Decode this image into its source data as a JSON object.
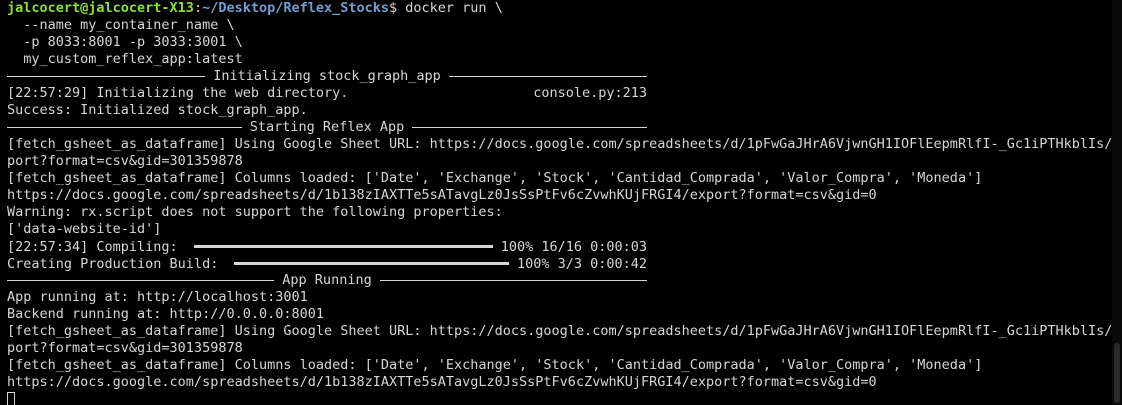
{
  "prompt": {
    "user": "jalcocert@jalcocert-X13",
    "separator": ":",
    "path": "~/Desktop/Reflex_Stocks",
    "symbol": "$",
    "command": " docker run \\"
  },
  "command_args": [
    "  --name my_container_name \\",
    "  -p 8033:8001 -p 3033:3001 \\",
    "  my_custom_reflex_app:latest"
  ],
  "sections": {
    "init": "Initializing stock_graph_app",
    "starting": "Starting Reflex App",
    "running": "App Running"
  },
  "init_log": {
    "message": "[22:57:29] Initializing the web directory.",
    "source": "console.py:213"
  },
  "success_line": "Success: Initialized stock_graph_app.",
  "starting_lines": [
    "[fetch_gsheet_as_dataframe] Using Google Sheet URL: https://docs.google.com/spreadsheets/d/1pFwGaJHrA6VjwnGH1IOFlEepmRlfI-_Gc1iPTHkblIs/ex",
    "port?format=csv&gid=301359878",
    "[fetch_gsheet_as_dataframe] Columns loaded: ['Date', 'Exchange', 'Stock', 'Cantidad_Comprada', 'Valor_Compra', 'Moneda']",
    "https://docs.google.com/spreadsheets/d/1b138zIAXTTe5sATavgLz0JsSsPtFv6cZvwhKUjFRGI4/export?format=csv&gid=0",
    "Warning: rx.script does not support the following properties:",
    "['data-website-id']"
  ],
  "progress": [
    {
      "label": "[22:57:34] Compiling: ",
      "stats": "100% 16/16 0:00:03",
      "fraction": 1.0
    },
    {
      "label": "Creating Production Build: ",
      "stats": "100% 3/3 0:00:42",
      "fraction": 1.0
    }
  ],
  "running_lines": [
    "App running at: http://localhost:3001",
    "Backend running at: http://0.0.0.0:8001",
    "[fetch_gsheet_as_dataframe] Using Google Sheet URL: https://docs.google.com/spreadsheets/d/1pFwGaJHrA6VjwnGH1IOFlEepmRlfI-_Gc1iPTHkblIs/ex",
    "port?format=csv&gid=301359878",
    "[fetch_gsheet_as_dataframe] Columns loaded: ['Date', 'Exchange', 'Stock', 'Cantidad_Comprada', 'Valor_Compra', 'Moneda']",
    "https://docs.google.com/spreadsheets/d/1b138zIAXTTe5sATavgLz0JsSsPtFv6cZvwhKUjFRGI4/export?format=csv&gid=0"
  ],
  "colors": {
    "background": "#000000",
    "text": "#d6d6d6",
    "prompt_user": "#8ae234",
    "prompt_path": "#729fcf"
  }
}
